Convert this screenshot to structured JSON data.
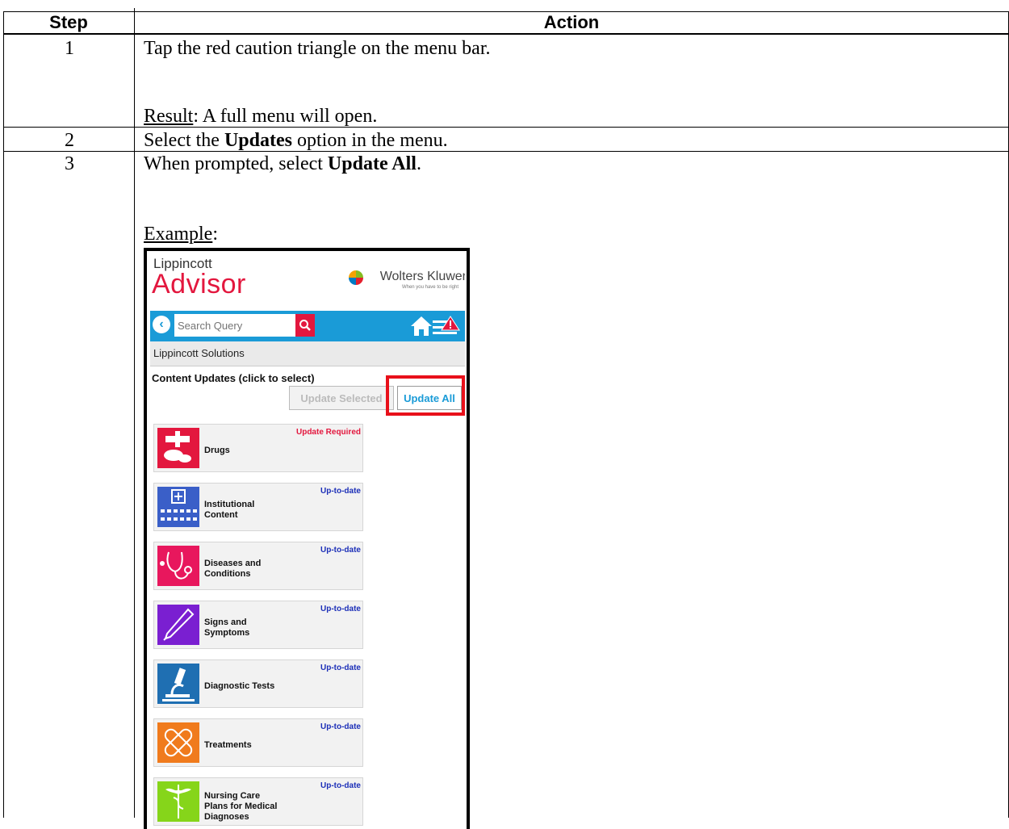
{
  "table": {
    "headers": {
      "step": "Step",
      "action": "Action"
    },
    "rows": [
      {
        "step": "1",
        "line1": "Tap the red caution triangle on the menu bar.",
        "result_label": "Result",
        "result_text": ":  A full menu will open."
      },
      {
        "step": "2",
        "pre": "Select the ",
        "bold": "Updates",
        "post": " option in the menu."
      },
      {
        "step": "3",
        "pre": "When prompted, select ",
        "bold": "Update All",
        "post": ".",
        "example_label": "Example",
        "example_colon": ":"
      }
    ]
  },
  "app": {
    "brand_small": "Lippincott",
    "brand_big": "Advisor",
    "publisher": "Wolters Kluwer",
    "tagline": "When you have to be right",
    "search": {
      "placeholder": "Search Query"
    },
    "breadcrumb": "Lippincott Solutions",
    "panel_title": "Content Updates (click to select)",
    "buttons": {
      "update_selected": "Update Selected",
      "update_all": "Update All"
    },
    "tiles": [
      {
        "name": "Drugs",
        "status": "Update Required",
        "icon": "drugs-icon",
        "color": "#e3173e"
      },
      {
        "name": "Institutional\nContent",
        "status": "Up-to-date",
        "icon": "hospital-icon",
        "color": "#3a5fc8"
      },
      {
        "name": "Diseases and\nConditions",
        "status": "Up-to-date",
        "icon": "stethoscope-icon",
        "color": "#e8175d"
      },
      {
        "name": "Signs and\nSymptoms",
        "status": "Up-to-date",
        "icon": "thermometer-icon",
        "color": "#7a1fd1"
      },
      {
        "name": "Diagnostic Tests",
        "status": "Up-to-date",
        "icon": "microscope-icon",
        "color": "#1f6fb2"
      },
      {
        "name": "Treatments",
        "status": "Up-to-date",
        "icon": "bandage-icon",
        "color": "#f07b1d"
      },
      {
        "name": "Nursing Care\nPlans for Medical\nDiagnoses",
        "status": "Up-to-date",
        "icon": "caduceus-icon",
        "color": "#86d51a"
      }
    ]
  }
}
